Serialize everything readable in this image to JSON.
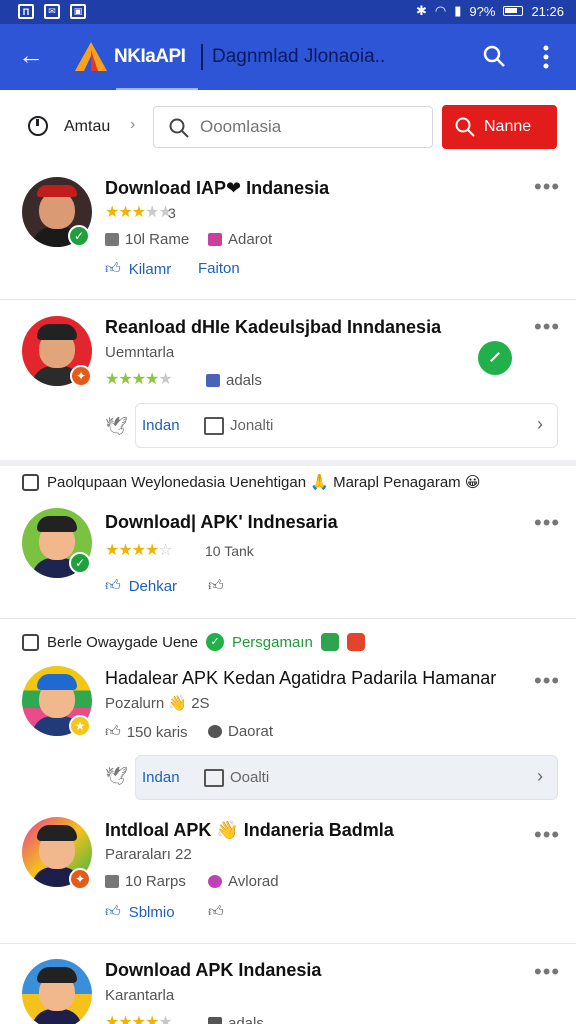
{
  "status_bar": {
    "time": "21:26",
    "battery": "9?%"
  },
  "app_bar": {
    "brand": "NKIaAPI",
    "title": "Dagnmlad Jlonaoia..",
    "back_icon": "back-arrow-icon",
    "search_icon": "search-icon",
    "more_icon": "more-vert-icon"
  },
  "filter": {
    "sort_label": "Amtau",
    "search_placeholder": "Ooomlasia",
    "name_button": "Nanne"
  },
  "cards": [
    {
      "title": "Download IAP❤ Indanesia",
      "rating": 2.5,
      "rating_num": "3",
      "meta1": "10l Rame",
      "meta2": "Adarot",
      "link1": "Kilamr",
      "link2": "Faiton"
    },
    {
      "title": "Reanload dHIe Kadeulsjbad Inndanesia",
      "subtitle": "Uemntarla",
      "rating": 4.5,
      "meta2": "adals",
      "bar_label1": "Indan",
      "bar_label2": "Jonalti"
    }
  ],
  "section1": {
    "text": "Paolqupaan Weylonedasia Uenehtigan 🙏 Marapl Penagaram 😀"
  },
  "cards2": [
    {
      "title": "Download| APK' Indnesaria",
      "rating": 3.5,
      "rating_num": "10 Tank",
      "link1": "Dehkar"
    }
  ],
  "section2": {
    "text1": "Berle Owaygade Uene",
    "text2": "Persgamaın"
  },
  "cards3": [
    {
      "title": "Hadalear APK Kedan Agatidra Padarila Hamanar",
      "subtitle": "Pozalurn 👋 2S",
      "meta1": "150 karis",
      "meta2": "Daorat",
      "bar_label1": "Indan",
      "bar_label2": "Ooalti"
    },
    {
      "title": "Intdloal APK 👋 Indaneria Badmla",
      "subtitle": "Pararaları 22",
      "meta1": "10 Rarps",
      "meta2": "Avlorad",
      "link1": "Sblmio"
    },
    {
      "title": "Download APK Indanesia",
      "subtitle": "Karantarla",
      "rating": 4.5,
      "meta2": "adals"
    }
  ],
  "colors": {
    "app_bar": "#2d55d6",
    "status_bar": "#1f3ea8",
    "accent_red": "#e21b1b",
    "link_blue": "#1f5fbf",
    "star": "#f0b400"
  }
}
